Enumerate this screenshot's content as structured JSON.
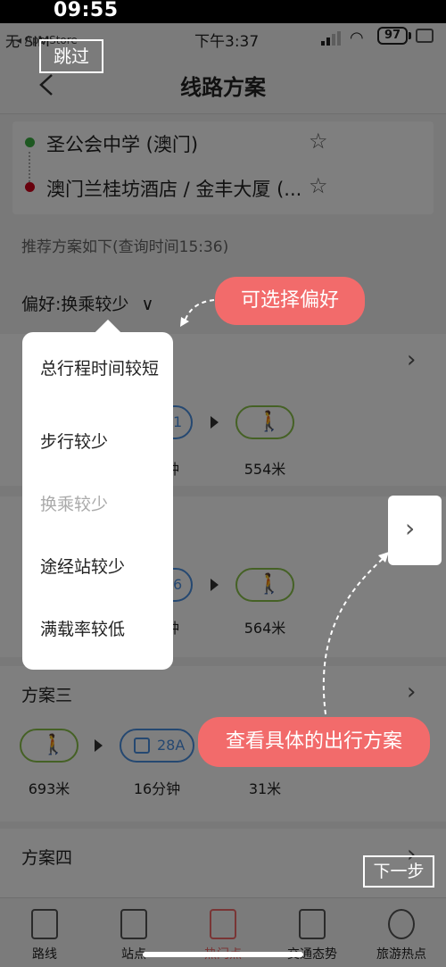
{
  "system": {
    "clock": "09:55",
    "carrier": "无 SIM",
    "app_store_back": "◂ App Store",
    "time": "下午3:37",
    "battery": "97"
  },
  "onboarding": {
    "skip_label": "跳过",
    "next_step_label": "下一步",
    "tip_preference": "可选择偏好",
    "tip_detail": "查看具体的出行方案"
  },
  "navbar": {
    "title": "线路方案",
    "back_icon": "chevron-left-icon"
  },
  "route": {
    "origin": "圣公会中学 (澳门)",
    "destination": "澳门兰桂坊酒店 / 金丰大厦 (...",
    "origin_color": "#3cb043",
    "destination_color": "#d0021b"
  },
  "hint": "推荐方案如下(查询时间15:36)",
  "preference": {
    "label": "偏好:换乘较少",
    "caret": "∨"
  },
  "dropdown": {
    "options": [
      {
        "label": "总行程时间较短",
        "disabled": false
      },
      {
        "label": "步行较少",
        "disabled": false
      },
      {
        "label": "换乘较少",
        "disabled": true
      },
      {
        "label": "途经站较少",
        "disabled": false
      },
      {
        "label": "满载率较低",
        "disabled": false
      }
    ]
  },
  "plans": [
    {
      "title": "",
      "segments": [
        {
          "type": "bus",
          "text": "1",
          "caption": "钟"
        },
        {
          "type": "walk",
          "caption": "554米"
        }
      ]
    },
    {
      "title": "",
      "segments": [
        {
          "type": "bus",
          "text": "6",
          "caption": "钟"
        },
        {
          "type": "walk",
          "caption": "564米"
        }
      ]
    },
    {
      "title": "方案三",
      "segments": [
        {
          "type": "walk",
          "caption": "693米"
        },
        {
          "type": "bus",
          "text": "28A",
          "caption": "16分钟"
        },
        {
          "type": "walk",
          "caption": "31米"
        }
      ]
    },
    {
      "title": "方案四",
      "segments": []
    }
  ],
  "tabs": [
    {
      "label": "路线",
      "icon": "bus-icon"
    },
    {
      "label": "站点",
      "icon": "bus-stop-icon"
    },
    {
      "label": "热门点",
      "icon": "map-pin-icon"
    },
    {
      "label": "交通态势",
      "icon": "traffic-icon"
    },
    {
      "label": "旅游热点",
      "icon": "hot-icon"
    }
  ],
  "colors": {
    "accent": "#f26b6b",
    "walk": "#8bc34a",
    "bus": "#4a90e2"
  }
}
